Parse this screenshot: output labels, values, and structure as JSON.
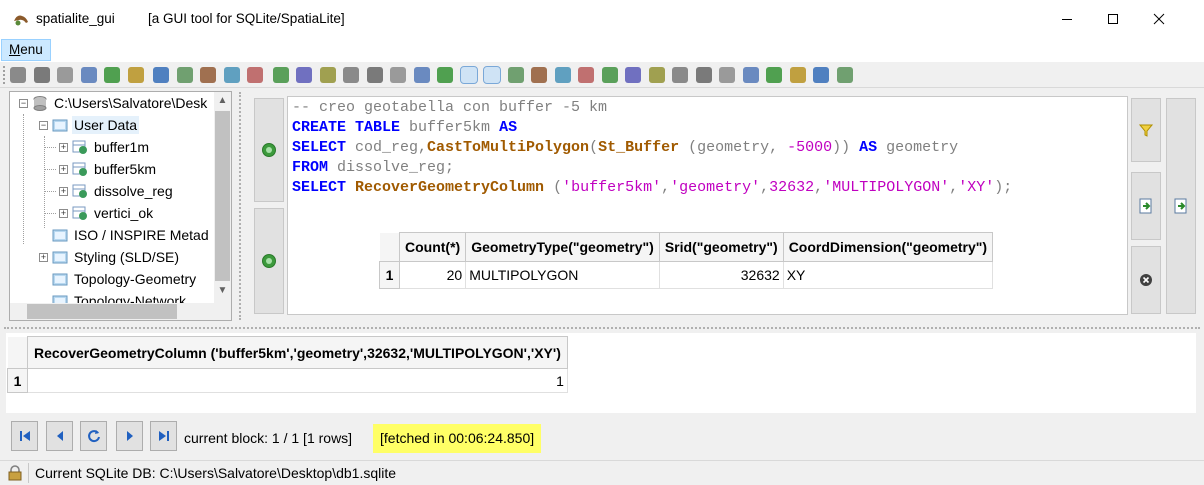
{
  "window": {
    "app_name": "spatialite_gui",
    "subtitle": "[a GUI tool for SQLite/SpatiaLite]"
  },
  "menubar": {
    "menu_label": "Menu",
    "menu_label_underlined": "M",
    "menu_label_rest": "enu"
  },
  "tree": {
    "items": [
      {
        "label": "C:\\Users\\Salvatore\\Desk"
      },
      {
        "label": "User Data"
      },
      {
        "label": "buffer1m"
      },
      {
        "label": "buffer5km"
      },
      {
        "label": "dissolve_reg"
      },
      {
        "label": "vertici_ok"
      },
      {
        "label": "ISO / INSPIRE Metad"
      },
      {
        "label": "Styling (SLD/SE)"
      },
      {
        "label": "Topology-Geometry"
      },
      {
        "label": "Topology-Network"
      }
    ]
  },
  "sql": {
    "line1": "-- creo geotabella con buffer -5 km",
    "line2_kw1": "CREATE TABLE",
    "line2_id": " buffer5km ",
    "line2_kw2": "AS",
    "line3_kw": "SELECT",
    "line3_id1": " cod_reg,",
    "line3_fn1": "CastToMultiPolygon",
    "line3_p1": "(",
    "line3_fn2": "St_Buffer",
    "line3_p2": " (geometry, ",
    "line3_num": "-5000",
    "line3_p3": ")) ",
    "line3_kw2": "AS",
    "line3_id2": " geometry",
    "line4_kw": "FROM",
    "line4_id": " dissolve_reg;",
    "line5_kw": "SELECT",
    "line5_fn": " RecoverGeometryColumn",
    "line5_p1": " (",
    "line5_s1": "'buffer5km'",
    "line5_c1": ",",
    "line5_s2": "'geometry'",
    "line5_c2": ",",
    "line5_n": "32632",
    "line5_c3": ",",
    "line5_s3": "'MULTIPOLYGON'",
    "line5_c4": ",",
    "line5_s4": "'XY'",
    "line5_p2": ");"
  },
  "mini_grid": {
    "headers": [
      "Count(*)",
      "GeometryType(\"geometry\")",
      "Srid(\"geometry\")",
      "CoordDimension(\"geometry\")"
    ],
    "rows": [
      {
        "num": "1",
        "cells": [
          "20",
          "MULTIPOLYGON",
          "32632",
          "XY"
        ]
      }
    ]
  },
  "result_grid": {
    "header": "RecoverGeometryColumn ('buffer5km','geometry',32632,'MULTIPOLYGON','XY')",
    "rows": [
      {
        "num": "1",
        "value": "1"
      }
    ]
  },
  "nav": {
    "block_info": "current block: 1 / 1 [1 rows]",
    "fetched": "[fetched in 00:06:24.850]"
  },
  "status": {
    "text": "Current SQLite DB: C:\\Users\\Salvatore\\Desktop\\db1.sqlite"
  },
  "colors": {
    "keyword": "#0000ff",
    "function": "#a05a00",
    "string": "#c000c0",
    "comment": "#808080",
    "fetched_highlight": "#ffff66",
    "menu_highlight": "#cce8ff"
  },
  "icons": [
    "app-icon",
    "minimize-icon",
    "maximize-icon",
    "close-icon",
    "execute-sql-icon",
    "history-icon",
    "filter-icon",
    "load-sql-icon",
    "save-sql-icon",
    "abort-icon",
    "first-page-icon",
    "previous-page-icon",
    "refresh-icon",
    "next-page-icon",
    "last-page-icon",
    "lock-icon"
  ]
}
